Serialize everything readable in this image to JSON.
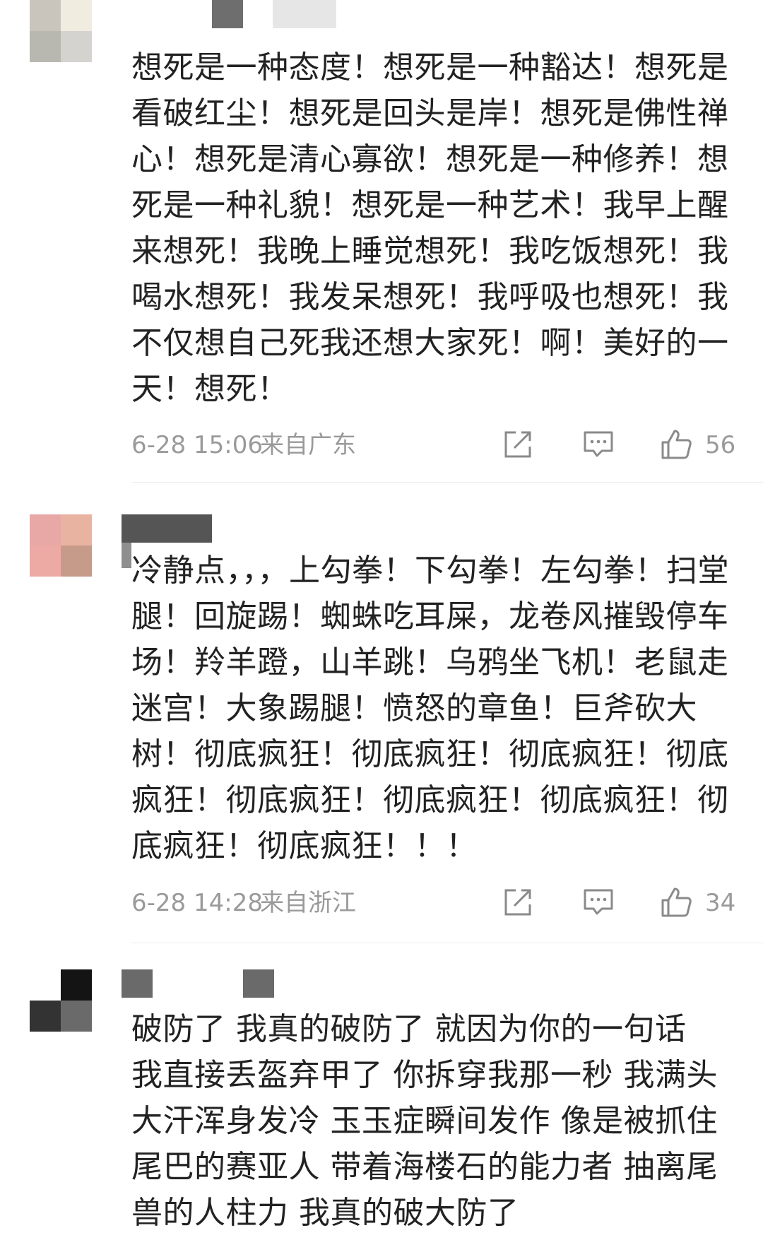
{
  "comments": [
    {
      "avatar_colors": [
        "#c9c5bd",
        "#f1ece0",
        "#b9b8b0",
        "#d4d3cf"
      ],
      "text": "想死是一种态度！想死是一种豁达！想死是看破红尘！想死是回头是岸！想死是佛性禅心！想死是清心寡欲！想死是一种修养！想死是一种礼貌！想死是一种艺术！我早上醒来想死！我晚上睡觉想死！我吃饭想死！我喝水想死！我发呆想死！我呼吸也想死！我不仅想自己死我还想大家死！啊！美好的一天！想死！",
      "time": "6-28 15:06",
      "location": "来自广东",
      "likes": "56"
    },
    {
      "avatar_colors": [
        "#e8a9a6",
        "#e9b3a2",
        "#eda9a3",
        "#c79b8a"
      ],
      "text": "冷静点，，，上勾拳！下勾拳！左勾拳！扫堂腿！回旋踢！蜘蛛吃耳屎，龙卷风摧毁停车场！羚羊蹬，山羊跳！乌鸦坐飞机！老鼠走迷宫！大象踢腿！愤怒的章鱼！巨斧砍大树！彻底疯狂！彻底疯狂！彻底疯狂！彻底疯狂！彻底疯狂！彻底疯狂！彻底疯狂！彻底疯狂！彻底疯狂！！！",
      "time": "6-28 14:28",
      "location": "来自浙江",
      "likes": "34"
    },
    {
      "avatar_colors": [
        "#ffffff",
        "#141414",
        "#333333",
        "#6a6a6a"
      ],
      "text": "破防了 我真的破防了 就因为你的一句话 我直接丢盔弃甲了 你拆穿我那一秒 我满头大汗浑身发冷 玉玉症瞬间发作 像是被抓住尾巴的赛亚人 带着海楼石的能力者 抽离尾兽的人柱力 我真的破大防了"
    }
  ],
  "icons": {
    "share": "share-icon",
    "comment": "comment-icon",
    "like": "thumbs-up-icon"
  }
}
